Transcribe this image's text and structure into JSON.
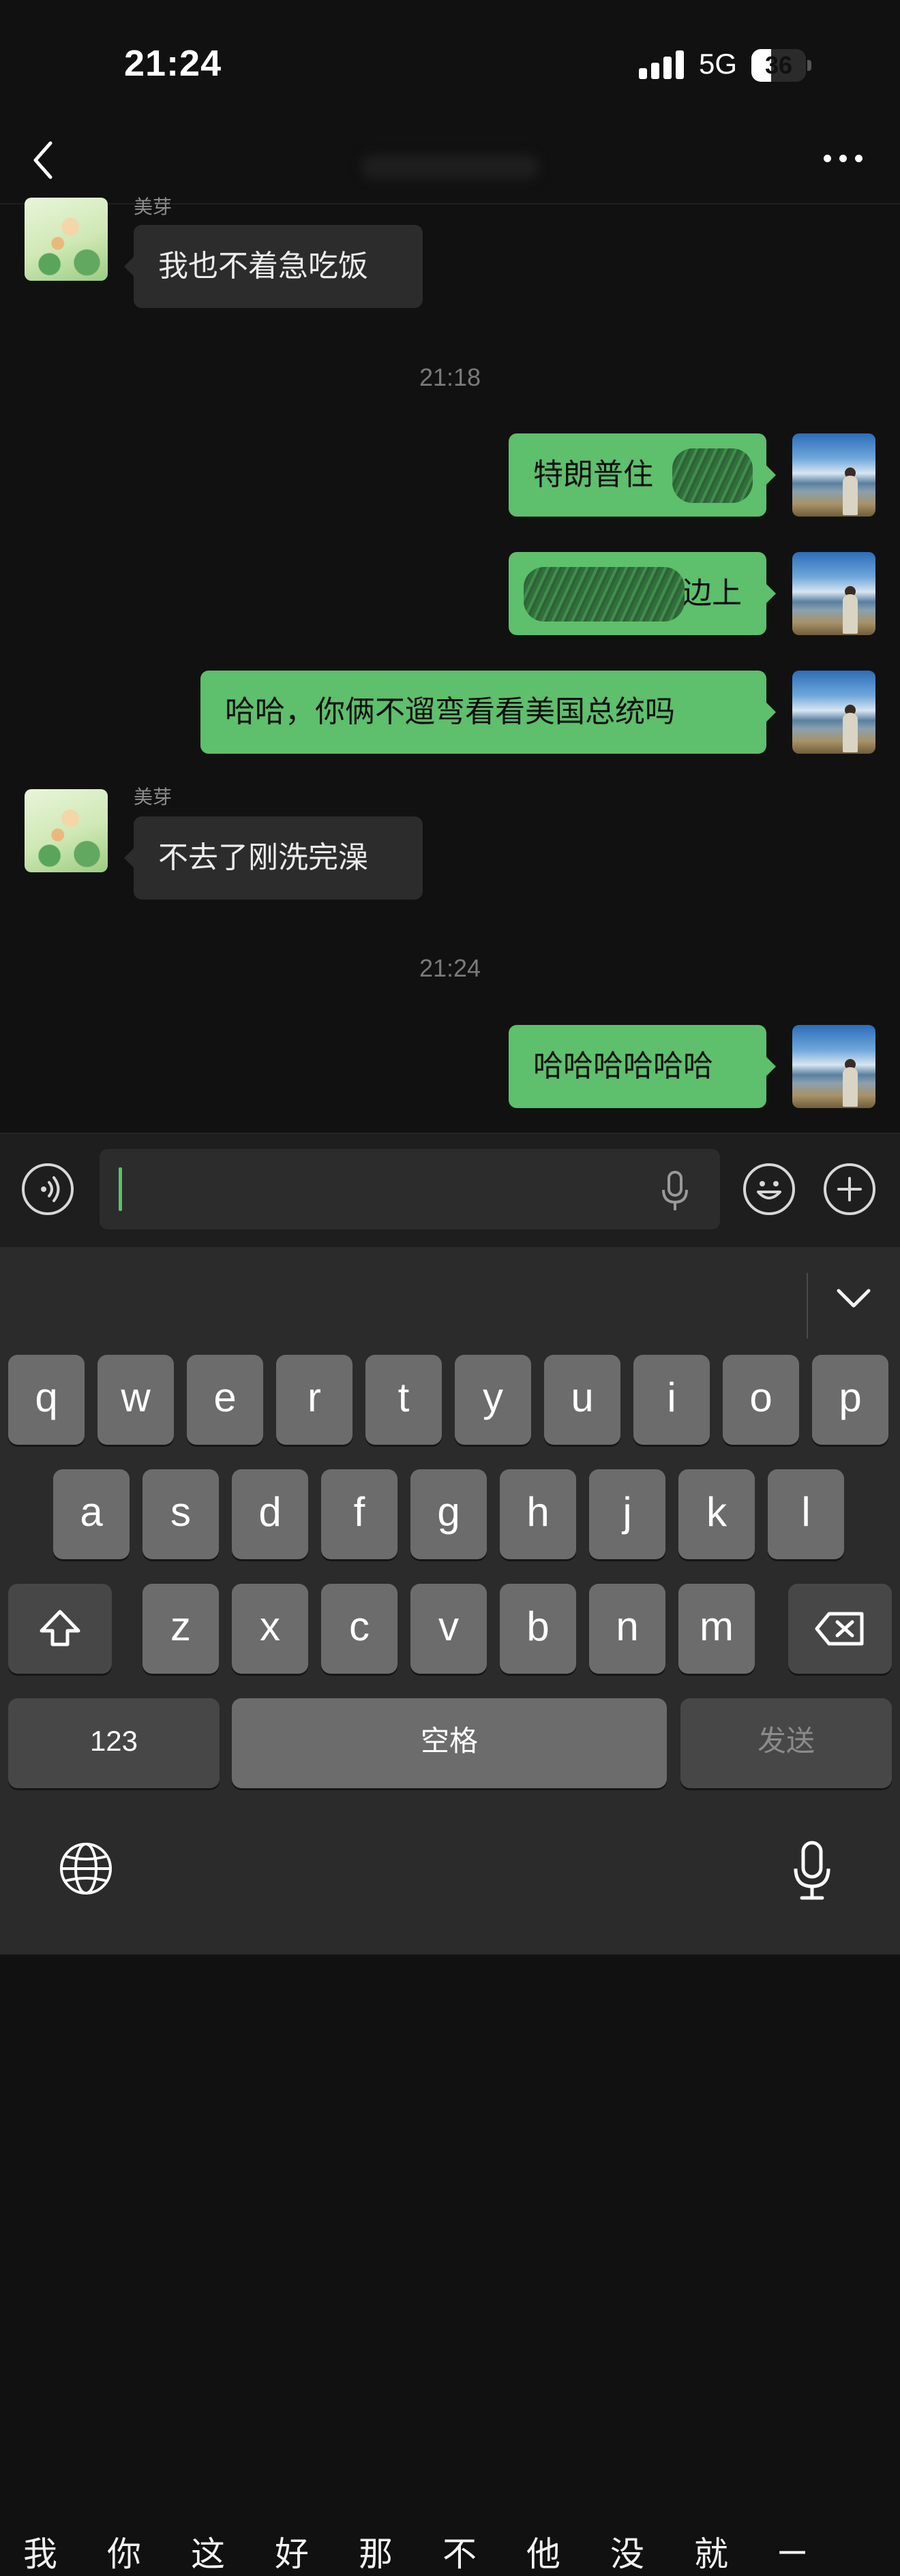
{
  "status_bar": {
    "time": "21:24",
    "network": "5G",
    "battery": "36",
    "battery_level": 0.36
  },
  "nav": {
    "title": ""
  },
  "messages": [
    {
      "side": "in",
      "sender": "美芽",
      "text": "我也不着急吃饭"
    },
    {
      "type": "time",
      "text": "21:18"
    },
    {
      "side": "out",
      "text": "特朗普住"
    },
    {
      "side": "out",
      "text": "边上"
    },
    {
      "side": "out",
      "text": "哈哈，你俩不遛弯看看美国总统吗"
    },
    {
      "side": "in",
      "sender": "美芽",
      "text": "不去了刚洗完澡"
    },
    {
      "type": "time",
      "text": "21:24"
    },
    {
      "side": "out",
      "text": "哈哈哈哈哈哈"
    }
  ],
  "input": {
    "value": ""
  },
  "keyboard": {
    "candidates": [
      "我",
      "你",
      "这",
      "好",
      "那",
      "不",
      "他",
      "没",
      "就",
      "一"
    ],
    "row1": [
      "q",
      "w",
      "e",
      "r",
      "t",
      "y",
      "u",
      "i",
      "o",
      "p"
    ],
    "row2": [
      "a",
      "s",
      "d",
      "f",
      "g",
      "h",
      "j",
      "k",
      "l"
    ],
    "row3": [
      "z",
      "x",
      "c",
      "v",
      "b",
      "n",
      "m"
    ],
    "numbers_key": "123",
    "space_key": "空格",
    "send_key": "发送"
  }
}
